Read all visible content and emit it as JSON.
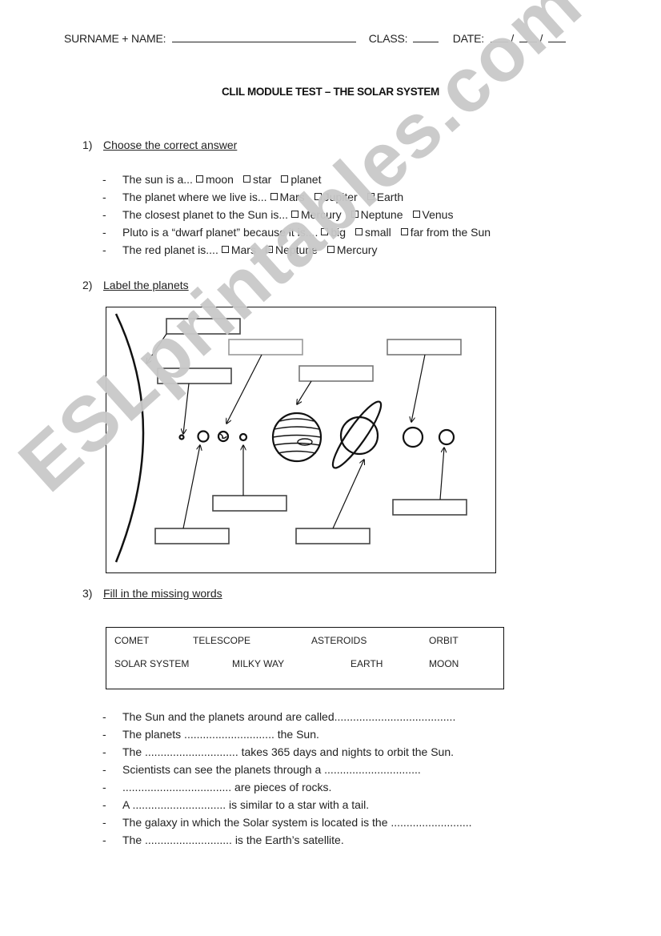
{
  "header": {
    "surname_label": "SURNAME + NAME:",
    "class_label": "CLASS:",
    "date_label": "DATE:",
    "date_sep": "/"
  },
  "title": "CLIL MODULE TEST – THE SOLAR SYSTEM",
  "section1": {
    "number": "1)",
    "label": "Choose the correct answer",
    "questions": [
      {
        "text": "The sun is a...",
        "options": [
          "moon",
          "star",
          "planet"
        ]
      },
      {
        "text": "The planet where we live is...",
        "options": [
          "Mars",
          "Jupiter",
          "Earth"
        ]
      },
      {
        "text": "The closest planet to the Sun is...",
        "options": [
          "Mercury",
          "Neptune",
          "Venus"
        ]
      },
      {
        "text": "Pluto is a “dwarf planet” because it is....",
        "options": [
          "big",
          "small",
          "far from the Sun"
        ]
      },
      {
        "text": "The red planet is....",
        "options": [
          "Mars",
          "Neptune",
          "Mercury"
        ]
      }
    ]
  },
  "section2": {
    "number": "2)",
    "label": "Label the planets"
  },
  "section3": {
    "number": "3)",
    "label": "Fill in the missing words",
    "word_bank": [
      "COMET",
      "TELESCOPE",
      "ASTEROIDS",
      "ORBIT",
      "SOLAR SYSTEM",
      "MILKY WAY",
      "EARTH",
      "MOON"
    ],
    "sentences": [
      "The Sun and the planets around are called.......................................",
      "The planets ............................. the Sun.",
      "The .............................. takes 365 days and nights to orbit the Sun.",
      "Scientists can see the planets through a ...............................",
      "................................... are pieces of rocks.",
      "A .............................. is similar to a star with a tail.",
      "The galaxy in which the Solar system is located is the ..........................",
      "The ............................ is the Earth’s satellite."
    ]
  },
  "watermark": "ESLprintables.com"
}
